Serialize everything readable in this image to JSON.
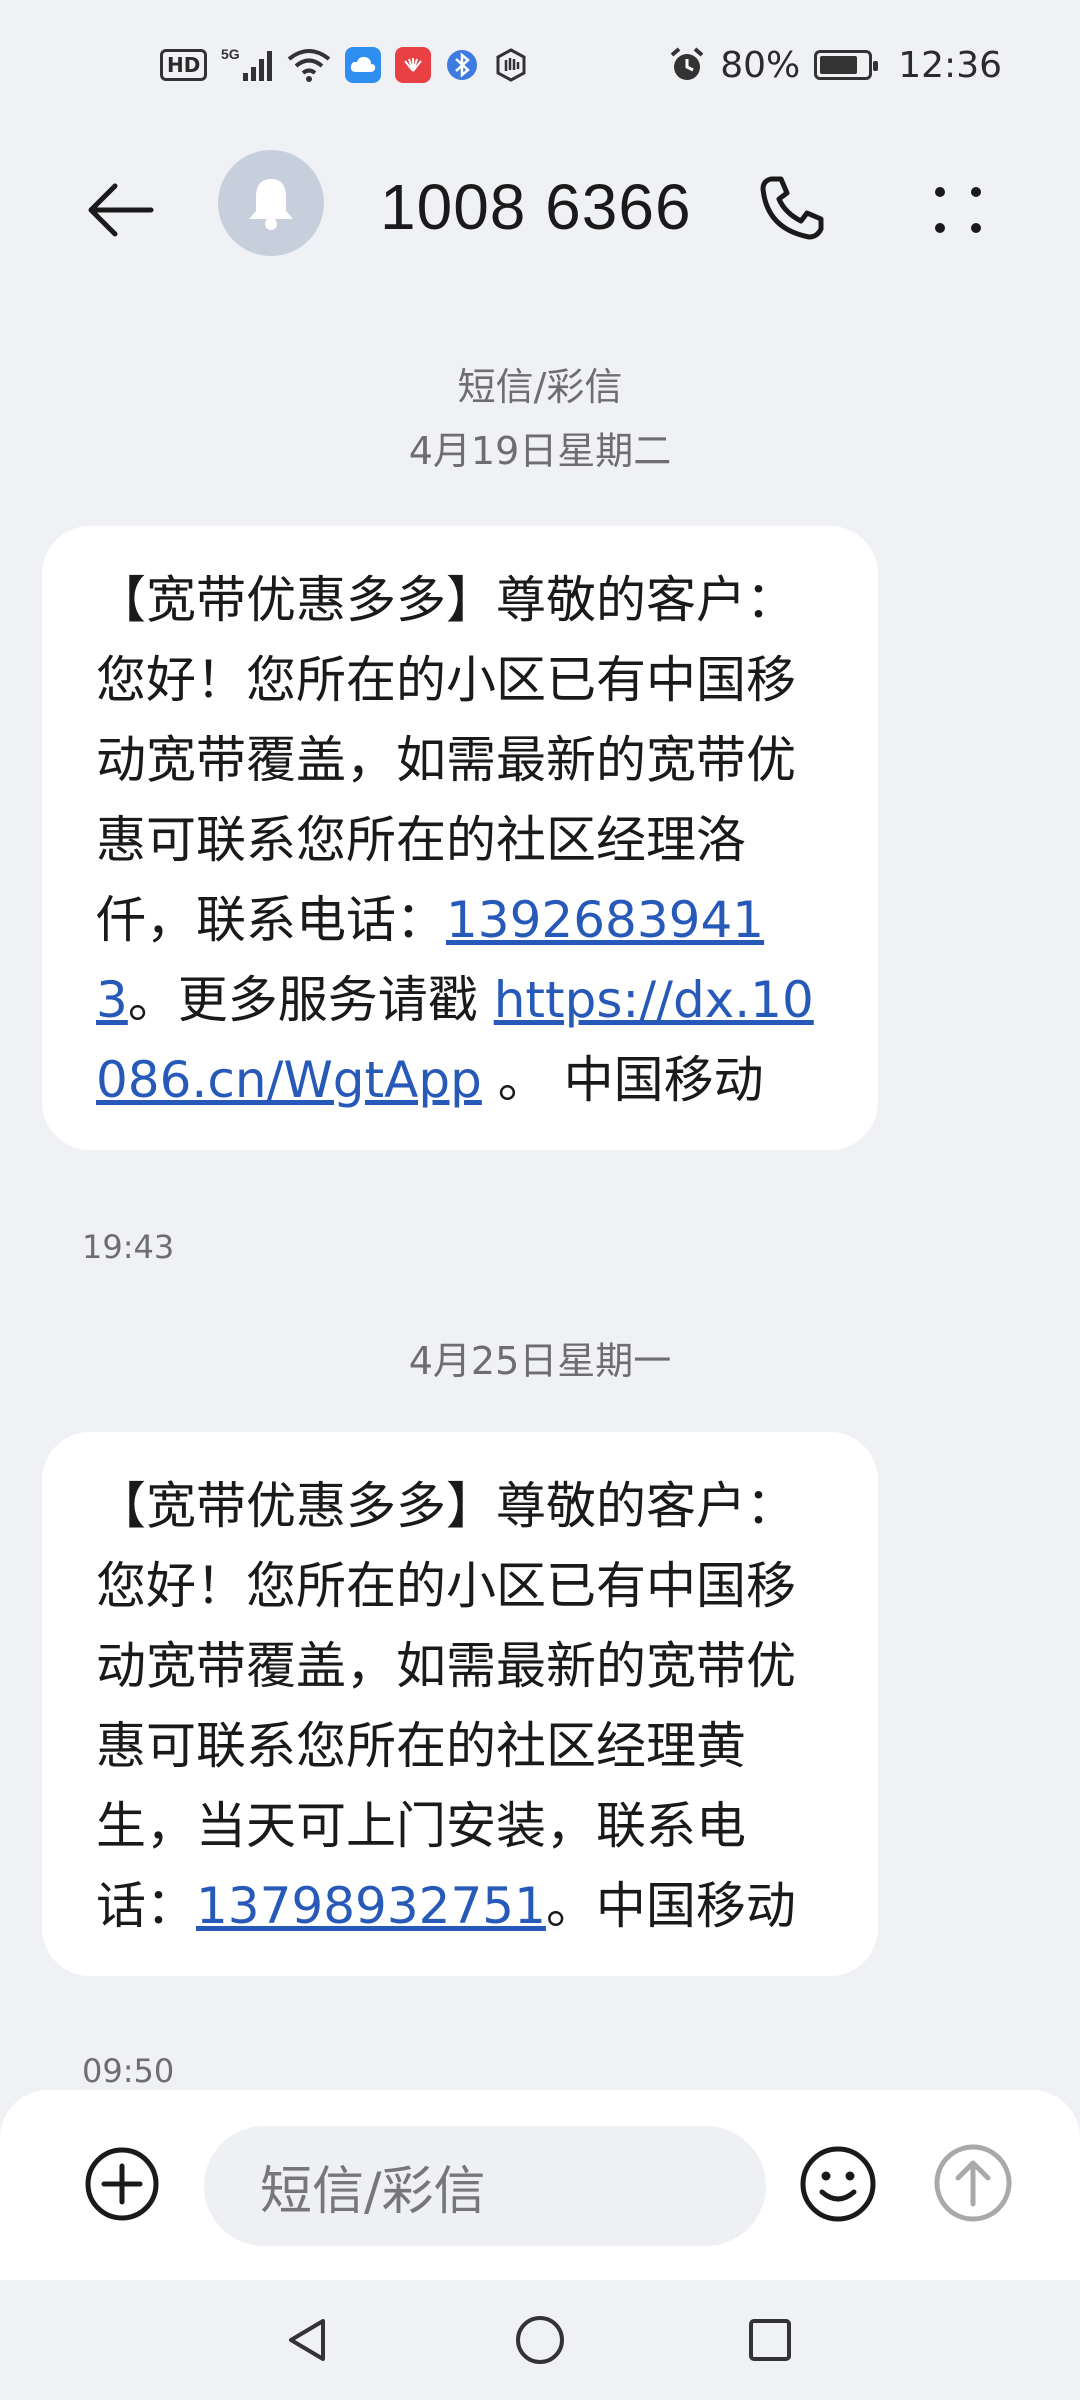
{
  "status_bar": {
    "hd_label": "HD",
    "network_label": "5G",
    "battery_percent": "80%",
    "battery_level": 0.8,
    "time": "12:36",
    "icons": [
      "hd-icon",
      "signal-icon",
      "wifi-icon",
      "cloud-app-icon",
      "huawei-app-icon",
      "bluetooth-app-icon",
      "hand-app-icon",
      "alarm-icon",
      "battery-icon"
    ]
  },
  "header": {
    "contact": "1008 6366",
    "avatar_icon": "bell-icon"
  },
  "conversation": {
    "type_label": "短信/彩信",
    "messages": [
      {
        "date": "4月19日星期二",
        "body_before_phone": "【宽带优惠多多】尊敬的客户：您好！您所在的小区已有中国移动宽带覆盖，如需最新的宽带优惠可联系您所在的社区经理洛仟，联系电话：",
        "phone": "13926839413",
        "body_after_phone": "。更多服务请戳 ",
        "link": "https://dx.10086.cn/WgtApp",
        "body_end": " 。 中国移动",
        "time": "19:43"
      },
      {
        "date": "4月25日星期一",
        "body_before_phone": "【宽带优惠多多】尊敬的客户：您好！您所在的小区已有中国移动宽带覆盖，如需最新的宽带优惠可联系您所在的社区经理黄生，当天可上门安装，联系电话：",
        "phone": "13798932751",
        "body_after_phone": "。中国移动",
        "time": "09:50"
      }
    ]
  },
  "composer": {
    "placeholder": "短信/彩信"
  },
  "colors": {
    "background": "#f0f1f5",
    "bubble": "#ffffff",
    "link": "#2659b8",
    "muted_text": "#6e6e6e"
  }
}
